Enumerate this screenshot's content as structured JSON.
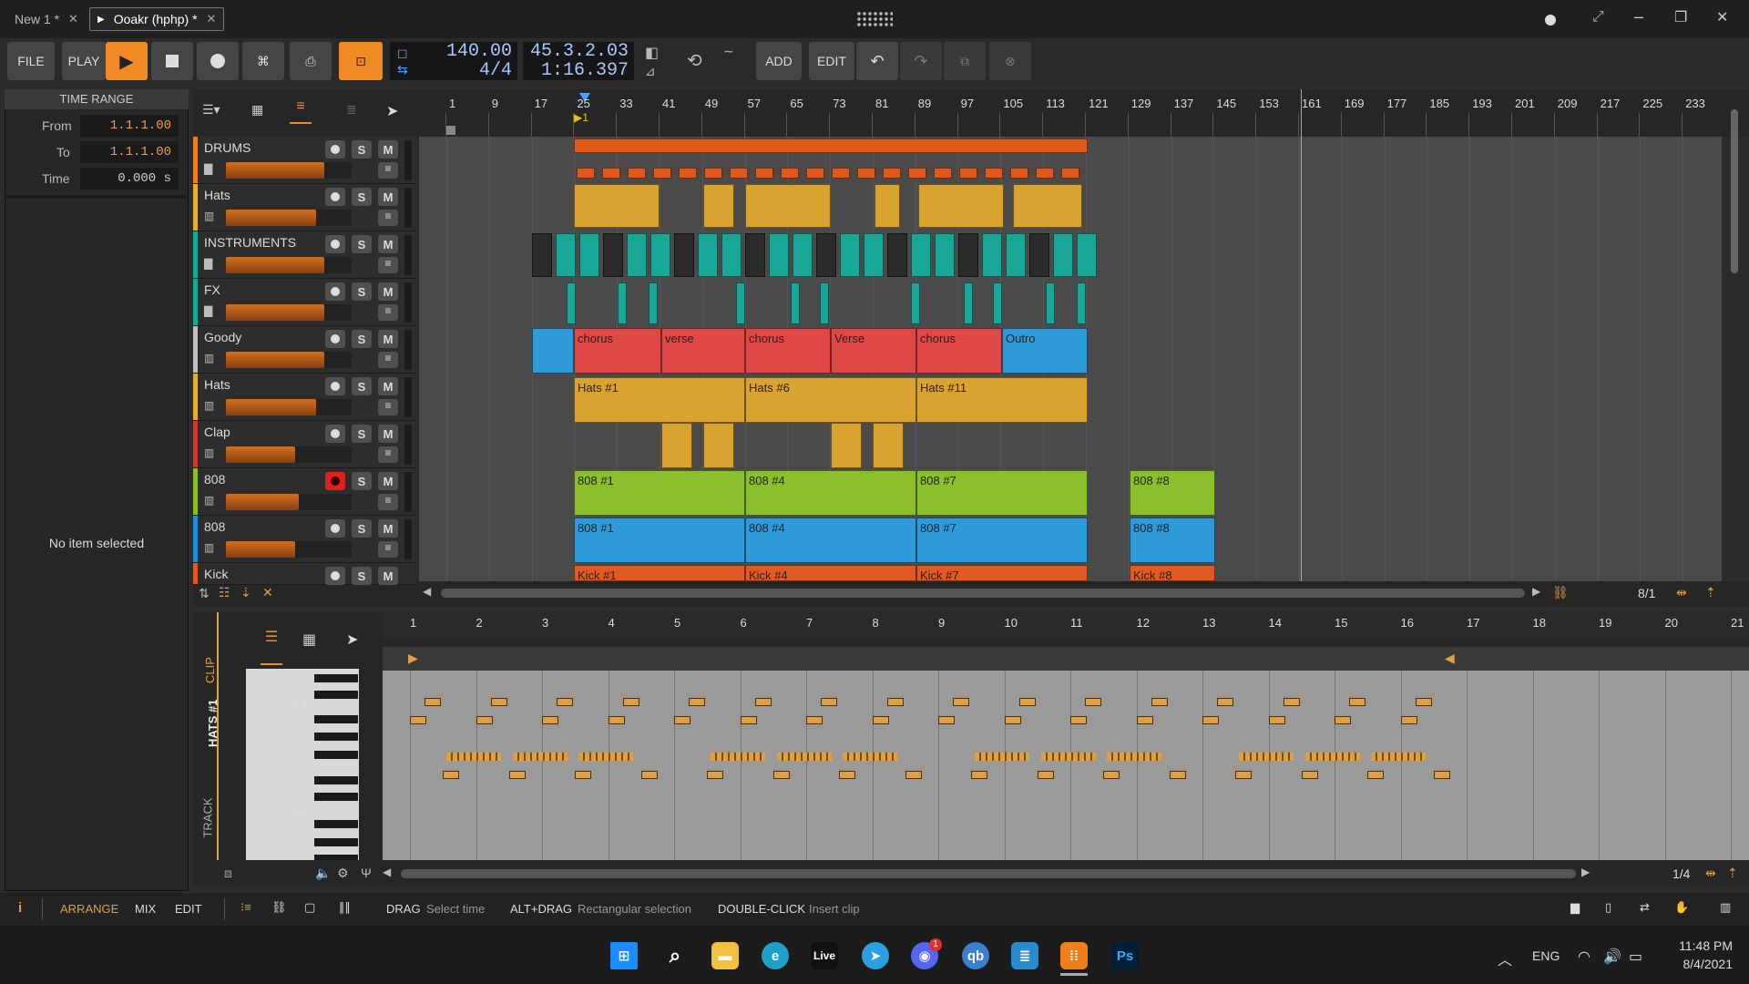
{
  "window": {
    "tabs": [
      {
        "label": "New 1 *"
      },
      {
        "label": "Ooakr (hphp) *"
      }
    ]
  },
  "transport": {
    "file": "FILE",
    "play": "PLAY",
    "tempo": "140.00",
    "signature": "4/4",
    "position": "45.3.2.03",
    "time": "1:16.397",
    "add": "ADD",
    "edit": "EDIT"
  },
  "time_range": {
    "title": "TIME RANGE",
    "from_label": "From",
    "from_value": "1.1.1.00",
    "to_label": "To",
    "to_value": "1.1.1.00",
    "time_label": "Time",
    "time_value": "0.000 s",
    "inspector_empty": "No item selected"
  },
  "ruler": [
    "1",
    "9",
    "17",
    "25",
    "33",
    "41",
    "49",
    "57",
    "65",
    "73",
    "81",
    "89",
    "97",
    "105",
    "113",
    "121",
    "129",
    "137",
    "145",
    "153",
    "161",
    "169",
    "177",
    "185",
    "193",
    "201",
    "209",
    "217",
    "225",
    "233"
  ],
  "tracks": [
    {
      "name": "DRUMS",
      "color": "#f07e1c",
      "fill": 0.78
    },
    {
      "name": "Hats",
      "color": "#e3b130",
      "fill": 0.72
    },
    {
      "name": "INSTRUMENTS",
      "color": "#19a897",
      "fill": 0.78
    },
    {
      "name": "FX",
      "color": "#19a897",
      "fill": 0.78
    },
    {
      "name": "Goody",
      "color": "#bfbfbf",
      "fill": 0.78
    },
    {
      "name": "Hats",
      "color": "#e3b130",
      "fill": 0.72
    },
    {
      "name": "Clap",
      "color": "#c93838",
      "fill": 0.55
    },
    {
      "name": "808",
      "color": "#8bbf2c",
      "fill": 0.58,
      "armed": true
    },
    {
      "name": "808",
      "color": "#1e8fd6",
      "fill": 0.55
    },
    {
      "name": "Kick",
      "color": "#e05a24",
      "fill": 0.6
    }
  ],
  "clips": {
    "goody": [
      "chorus",
      "verse",
      "chorus",
      "Verse",
      "chorus",
      "Outro"
    ],
    "hats": [
      "Hats #1",
      "Hats #6",
      "Hats #11"
    ],
    "b808a": [
      "808 #1",
      "808 #4",
      "808 #7",
      "808 #8"
    ],
    "b808b": [
      "808 #1",
      "808 #4",
      "808 #7",
      "808 #8"
    ],
    "kick": [
      "Kick #1",
      "Kick #4",
      "Kick #7",
      "Kick #8"
    ]
  },
  "arrange_zoom": "8/1",
  "editor": {
    "clip_label": "CLIP",
    "clip_name": "HATS #1",
    "track_label": "TRACK",
    "key_c3": "C3",
    "key_c2": "C2",
    "ruler": [
      "1",
      "2",
      "3",
      "4",
      "5",
      "6",
      "7",
      "8",
      "9",
      "10",
      "11",
      "12",
      "13",
      "14",
      "15",
      "16",
      "17",
      "18",
      "19",
      "20",
      "21"
    ],
    "zoom": "1/4"
  },
  "status": {
    "arrange": "ARRANGE",
    "mix": "MIX",
    "edit": "EDIT",
    "hints": [
      {
        "key": "DRAG",
        "desc": "Select time"
      },
      {
        "key": "ALT+DRAG",
        "desc": "Rectangular selection"
      },
      {
        "key": "DOUBLE-CLICK",
        "desc": "Insert clip"
      }
    ]
  },
  "taskbar": {
    "live": "Live",
    "ps": "Ps",
    "qb": "qb",
    "discord_badge": "1",
    "lang": "ENG",
    "clock": "11:48 PM",
    "date": "8/4/2021"
  }
}
